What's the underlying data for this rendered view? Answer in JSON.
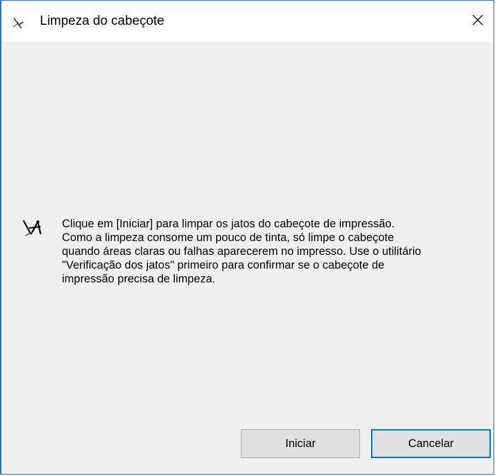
{
  "window": {
    "title": "Limpeza do cabeçote",
    "title_icon": "nozzle-tool-icon",
    "close_icon": "close-icon"
  },
  "content": {
    "icon": "nozzle-tool-icon",
    "lines": [
      "Clique em [Iniciar] para limpar os jatos do cabeçote de impressão.",
      "Como a limpeza consome um pouco de tinta, só limpe o cabeçote",
      "quando áreas claras ou falhas aparecerem no impresso. Use o utilitário",
      "\"Verificação dos jatos\" primeiro para confirmar se o cabeçote de",
      "impressão precisa de limpeza."
    ]
  },
  "buttons": {
    "start_label": "Iniciar",
    "cancel_label": "Cancelar",
    "default_accent": "#0078d7"
  }
}
